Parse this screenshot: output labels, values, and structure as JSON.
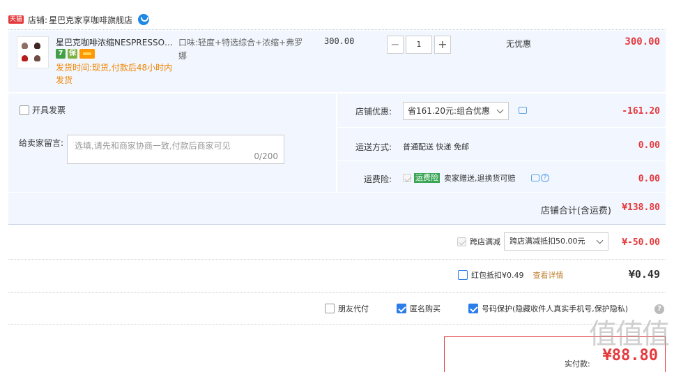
{
  "shop": {
    "badge": "天猫",
    "label": "店铺:",
    "name": "星巴克家享咖啡旗舰店"
  },
  "item": {
    "title": "星巴克咖啡浓缩NESPRESSO胶...",
    "badge_seven": "7",
    "badge_guarantee": "保",
    "ship_time": "发货时间:现货,付款后48小时内发货",
    "attr": "口味:轻度+特选综合+浓缩+弗罗娜",
    "price": "300.00",
    "quantity": "1",
    "minus": "−",
    "plus": "+",
    "discount": "无优惠",
    "total": "300.00"
  },
  "options": {
    "invoice_label": "开具发票",
    "message_label": "给卖家留言:",
    "message_placeholder": "选填,请先和商家协商一致,付款后商家可见",
    "message_count": "0/200",
    "shop_promo_label": "店铺优惠:",
    "shop_promo_value": "省161.20元:组合优惠",
    "shop_promo_amount": "-161.20",
    "shipping_label": "运送方式:",
    "shipping_value": "普通配送 快递 免邮",
    "shipping_amount": "0.00",
    "insurance_label": "运费险:",
    "insurance_tag": "运费险",
    "insurance_text": "卖家赠送,退换货可赔",
    "insurance_amount": "0.00"
  },
  "subtotal": {
    "label": "店铺合计(含运费)",
    "value": "¥138.80"
  },
  "cross_store": {
    "label": "跨店满减",
    "select_value": "跨店满减抵扣50.00元",
    "amount": "¥-50.00"
  },
  "red_packet": {
    "label": "红包抵扣¥0.49",
    "link": "查看详情",
    "amount": "¥0.49"
  },
  "privacy": {
    "friend_pay": "朋友代付",
    "anonymous": "匿名购买",
    "number_protect": "号码保护(隐藏收件人真实手机号,保护隐私)",
    "help": "?"
  },
  "payment": {
    "label": "实付款:",
    "value": "¥88.80"
  },
  "watermark": "值值值",
  "colors": {
    "accent_red": "#e4393c",
    "row_bg": "#f2f7ff",
    "link_blue": "#2b7de9",
    "ship_orange": "#f08300"
  }
}
